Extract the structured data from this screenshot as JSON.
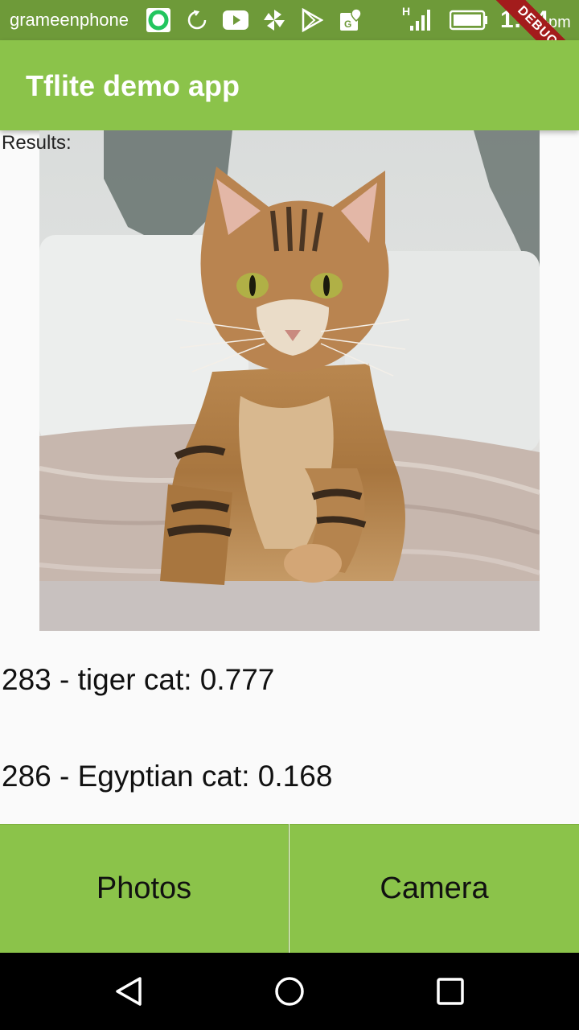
{
  "status_bar": {
    "carrier": "grameenphone",
    "network_type": "H",
    "time": "1:04",
    "am_pm": "pm",
    "icons": [
      "app-circle-icon",
      "sync-icon",
      "youtube-icon",
      "pinwheel-icon",
      "play-store-icon",
      "maps-icon",
      "signal-icon",
      "battery-icon"
    ]
  },
  "debug_banner": "DEBUG",
  "app_bar": {
    "title": "Tflite demo app",
    "color": "#8bc34a"
  },
  "content": {
    "results_label": "Results:",
    "image": {
      "subject": "tabby cat"
    },
    "results": [
      {
        "text": "283 - tiger cat: 0.777"
      },
      {
        "text": "286 - Egyptian cat: 0.168"
      }
    ]
  },
  "buttons": {
    "photos": "Photos",
    "camera": "Camera"
  },
  "nav": {
    "back": "back-icon",
    "home": "home-icon",
    "recents": "recents-icon"
  }
}
